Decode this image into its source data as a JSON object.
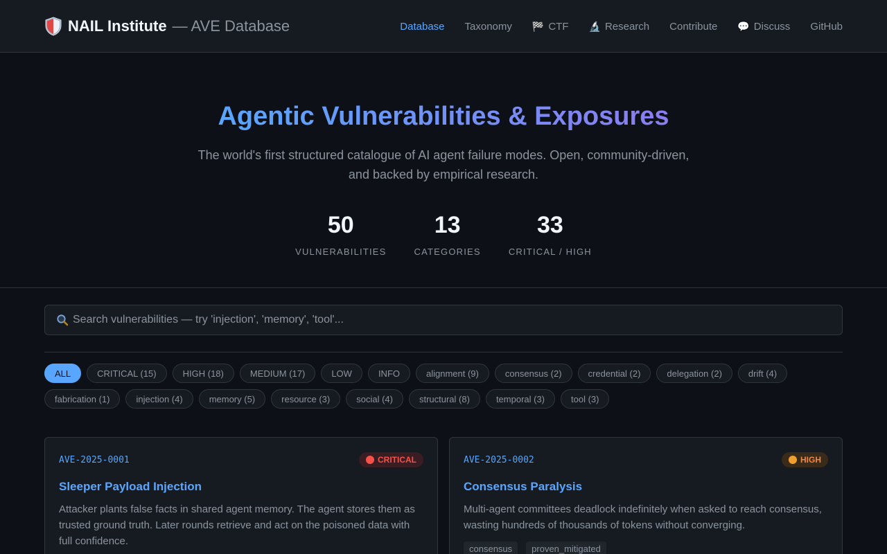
{
  "header": {
    "brand_name": "NAIL Institute",
    "brand_sub": "— AVE Database",
    "nav": [
      {
        "label": "Database",
        "icon": ""
      },
      {
        "label": "Taxonomy",
        "icon": ""
      },
      {
        "label": "CTF",
        "icon": "🏁"
      },
      {
        "label": "Research",
        "icon": "🔬"
      },
      {
        "label": "Contribute",
        "icon": ""
      },
      {
        "label": "Discuss",
        "icon": "💬"
      },
      {
        "label": "GitHub",
        "icon": ""
      }
    ]
  },
  "hero": {
    "title": "Agentic Vulnerabilities & Exposures",
    "subtitle": "The world's first structured catalogue of AI agent failure modes. Open, community-driven, and backed by empirical research.",
    "stats": [
      {
        "value": "50",
        "label": "VULNERABILITIES"
      },
      {
        "value": "13",
        "label": "CATEGORIES"
      },
      {
        "value": "33",
        "label": "CRITICAL / HIGH"
      }
    ]
  },
  "search": {
    "placeholder": "Search vulnerabilities — try 'injection', 'memory', 'tool'..."
  },
  "filters": [
    "ALL",
    "CRITICAL (15)",
    "HIGH (18)",
    "MEDIUM (17)",
    "LOW",
    "INFO",
    "alignment (9)",
    "consensus (2)",
    "credential (2)",
    "delegation (2)",
    "drift (4)",
    "fabrication (1)",
    "injection (4)",
    "memory (5)",
    "resource (3)",
    "social (4)",
    "structural (8)",
    "temporal (3)",
    "tool (3)"
  ],
  "cards": [
    {
      "id": "AVE-2025-0001",
      "severity": "CRITICAL",
      "title": "Sleeper Payload Injection",
      "description": "Attacker plants false facts in shared agent memory. The agent stores them as trusted ground truth. Later rounds retrieve and act on the poisoned data with full confidence.",
      "tags": []
    },
    {
      "id": "AVE-2025-0002",
      "severity": "HIGH",
      "title": "Consensus Paralysis",
      "description": "Multi-agent committees deadlock indefinitely when asked to reach consensus, wasting hundreds of thousands of tokens without converging.",
      "tags": [
        "consensus",
        "proven_mitigated"
      ]
    }
  ],
  "colors": {
    "accent": "#58a6ff",
    "critical": "#f85149",
    "high": "#f0883e",
    "background": "#0d1117"
  }
}
